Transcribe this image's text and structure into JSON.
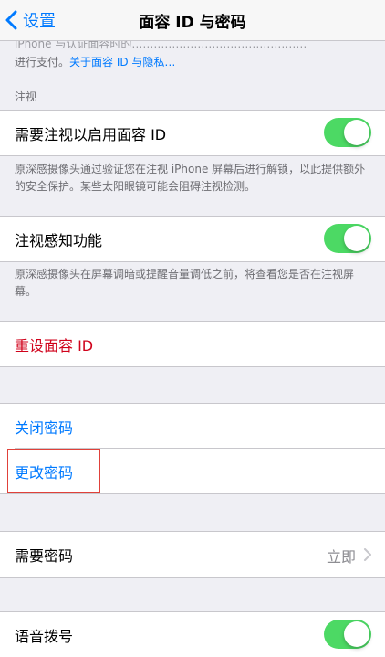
{
  "nav": {
    "back_label": "设置",
    "title": "面容 ID 与密码"
  },
  "intro": {
    "partial_line": "iPhone 与认证面容时的…………………………………………",
    "line2_prefix": "进行支付。",
    "link": "关于面容 ID 与隐私…"
  },
  "attention": {
    "header": "注视",
    "require_attention": {
      "label": "需要注视以启用面容 ID",
      "enabled": true
    },
    "require_attention_footer": "原深感摄像头通过验证您在注视 iPhone 屏幕后进行解锁，以此提供额外的安全保护。某些太阳眼镜可能会阻碍注视检测。",
    "attention_aware": {
      "label": "注视感知功能",
      "enabled": true
    },
    "attention_aware_footer": "原深感摄像头在屏幕调暗或提醒音量调低之前，将查看您是否在注视屏幕。"
  },
  "reset_face_id": {
    "label": "重设面容 ID"
  },
  "passcode": {
    "turn_off": "关闭密码",
    "change": "更改密码"
  },
  "require_passcode": {
    "label": "需要密码",
    "value": "立即"
  },
  "voice_dial": {
    "label": "语音拨号",
    "enabled": true
  },
  "colors": {
    "accent": "#007aff",
    "destructive": "#d0021b",
    "toggle_on": "#4cd964",
    "highlight": "#e0413a"
  }
}
